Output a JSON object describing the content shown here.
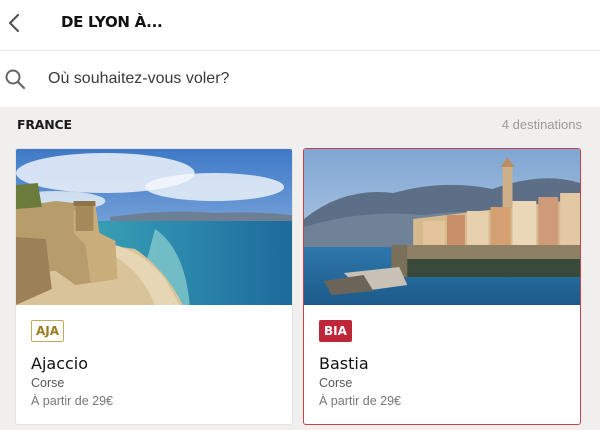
{
  "header": {
    "title": "DE LYON À..."
  },
  "search": {
    "placeholder": "Où souhaitez-vous voler?"
  },
  "section": {
    "country": "FRANCE",
    "count": "4 destinations"
  },
  "destinations": [
    {
      "code": "AJA",
      "city": "Ajaccio",
      "region": "Corse",
      "price": "À partir de 29€"
    },
    {
      "code": "BIA",
      "city": "Bastia",
      "region": "Corse",
      "price": "À partir de 29€"
    }
  ],
  "colors": {
    "accent": "#c0263a",
    "selected_border": "#c9414b",
    "aja_badge": "#9a7d1f"
  }
}
